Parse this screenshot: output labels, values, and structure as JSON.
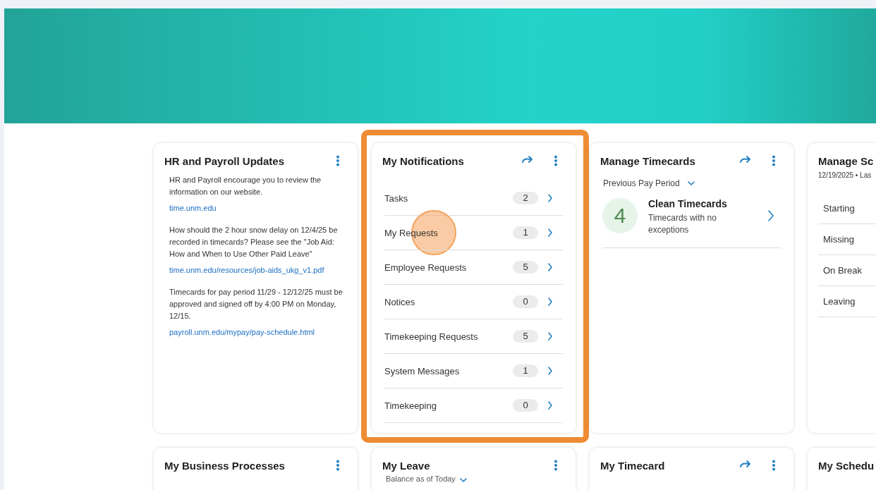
{
  "cards_row_1": [
    {
      "kind": "updates",
      "title": "HR and Payroll Updates",
      "arrow": false,
      "menu": true,
      "paragraphs": [
        {
          "text": "HR and Payroll encourage you to review the information on our website.",
          "link": "time.unm.edu"
        },
        {
          "text": "How should the 2 hour snow delay on 12/4/25 be recorded in timecards? Please see the \"Job Aid: How and When to Use Other Paid Leave\"",
          "link": "time.unm.edu/resources/job-aids_ukg_v1.pdf"
        },
        {
          "text": "Timecards for pay period 11/29 - 12/12/25 must be approved and signed off by 4:00 PM on Monday, 12/15.",
          "link": "payroll.unm.edu/mypay/pay-schedule.html"
        }
      ]
    },
    {
      "kind": "notifications",
      "title": "My Notifications",
      "arrow": true,
      "menu": true,
      "highlighted": true,
      "items": [
        {
          "label": "Tasks",
          "count": "2"
        },
        {
          "label": "My Requests",
          "count": "1",
          "clicked": true
        },
        {
          "label": "Employee Requests",
          "count": "5"
        },
        {
          "label": "Notices",
          "count": "0"
        },
        {
          "label": "Timekeeping Requests",
          "count": "5"
        },
        {
          "label": "System Messages",
          "count": "1"
        },
        {
          "label": "Timekeeping",
          "count": "0"
        }
      ]
    },
    {
      "kind": "timecards",
      "title": "Manage Timecards",
      "arrow": true,
      "menu": true,
      "period": "Previous Pay Period",
      "summary": {
        "count": "4",
        "title": "Clean Timecards",
        "description": "Timecards with no exceptions"
      }
    },
    {
      "kind": "schedule",
      "title": "Manage Sc",
      "subtitle": "12/19/2025 • Las",
      "items": [
        "Starting",
        "Missing",
        "On Break",
        "Leaving"
      ]
    }
  ],
  "cards_row_2": [
    {
      "title": "My Business Processes",
      "arrow": false,
      "menu": true
    },
    {
      "title": "My Leave",
      "arrow": false,
      "menu": true,
      "subtitle": "Balance as of Today"
    },
    {
      "title": "My Timecard",
      "arrow": true,
      "menu": true
    },
    {
      "title": "My Schedu",
      "arrow": false,
      "menu": false
    }
  ]
}
